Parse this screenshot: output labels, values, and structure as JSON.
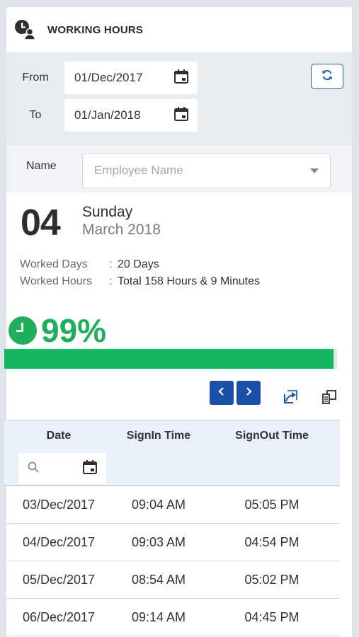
{
  "header": {
    "title": "WORKING HOURS",
    "icon": "clock-user-icon"
  },
  "filters": {
    "from_label": "From",
    "from_value": "01/Dec/2017",
    "to_label": "To",
    "to_value": "01/Jan/2018",
    "refresh_icon": "refresh-icon"
  },
  "name_filter": {
    "label": "Name",
    "placeholder": "Employee Name"
  },
  "summary": {
    "day_number": "04",
    "day_name": "Sunday",
    "month_year": "March 2018",
    "worked_days_label": "Worked Days",
    "worked_days_value": "20 Days",
    "worked_hours_label": "Worked Hours",
    "worked_hours_value": "Total 158 Hours & 9 Minutes",
    "colon": ":",
    "percentage": "99%",
    "progress_fraction": 0.99,
    "accent_color": "#1fae5b",
    "brand_color": "#1b4fa8"
  },
  "table": {
    "columns": [
      "Date",
      "SignIn Time",
      "SignOut Time"
    ],
    "rows": [
      {
        "date": "03/Dec/2017",
        "signin": "09:04 AM",
        "signout": "05:05 PM"
      },
      {
        "date": "04/Dec/2017",
        "signin": "09:03 AM",
        "signout": "04:54 PM"
      },
      {
        "date": "05/Dec/2017",
        "signin": "08:54 AM",
        "signout": "05:02 PM"
      },
      {
        "date": "06/Dec/2017",
        "signin": "09:14 AM",
        "signout": "04:45 PM"
      }
    ]
  }
}
